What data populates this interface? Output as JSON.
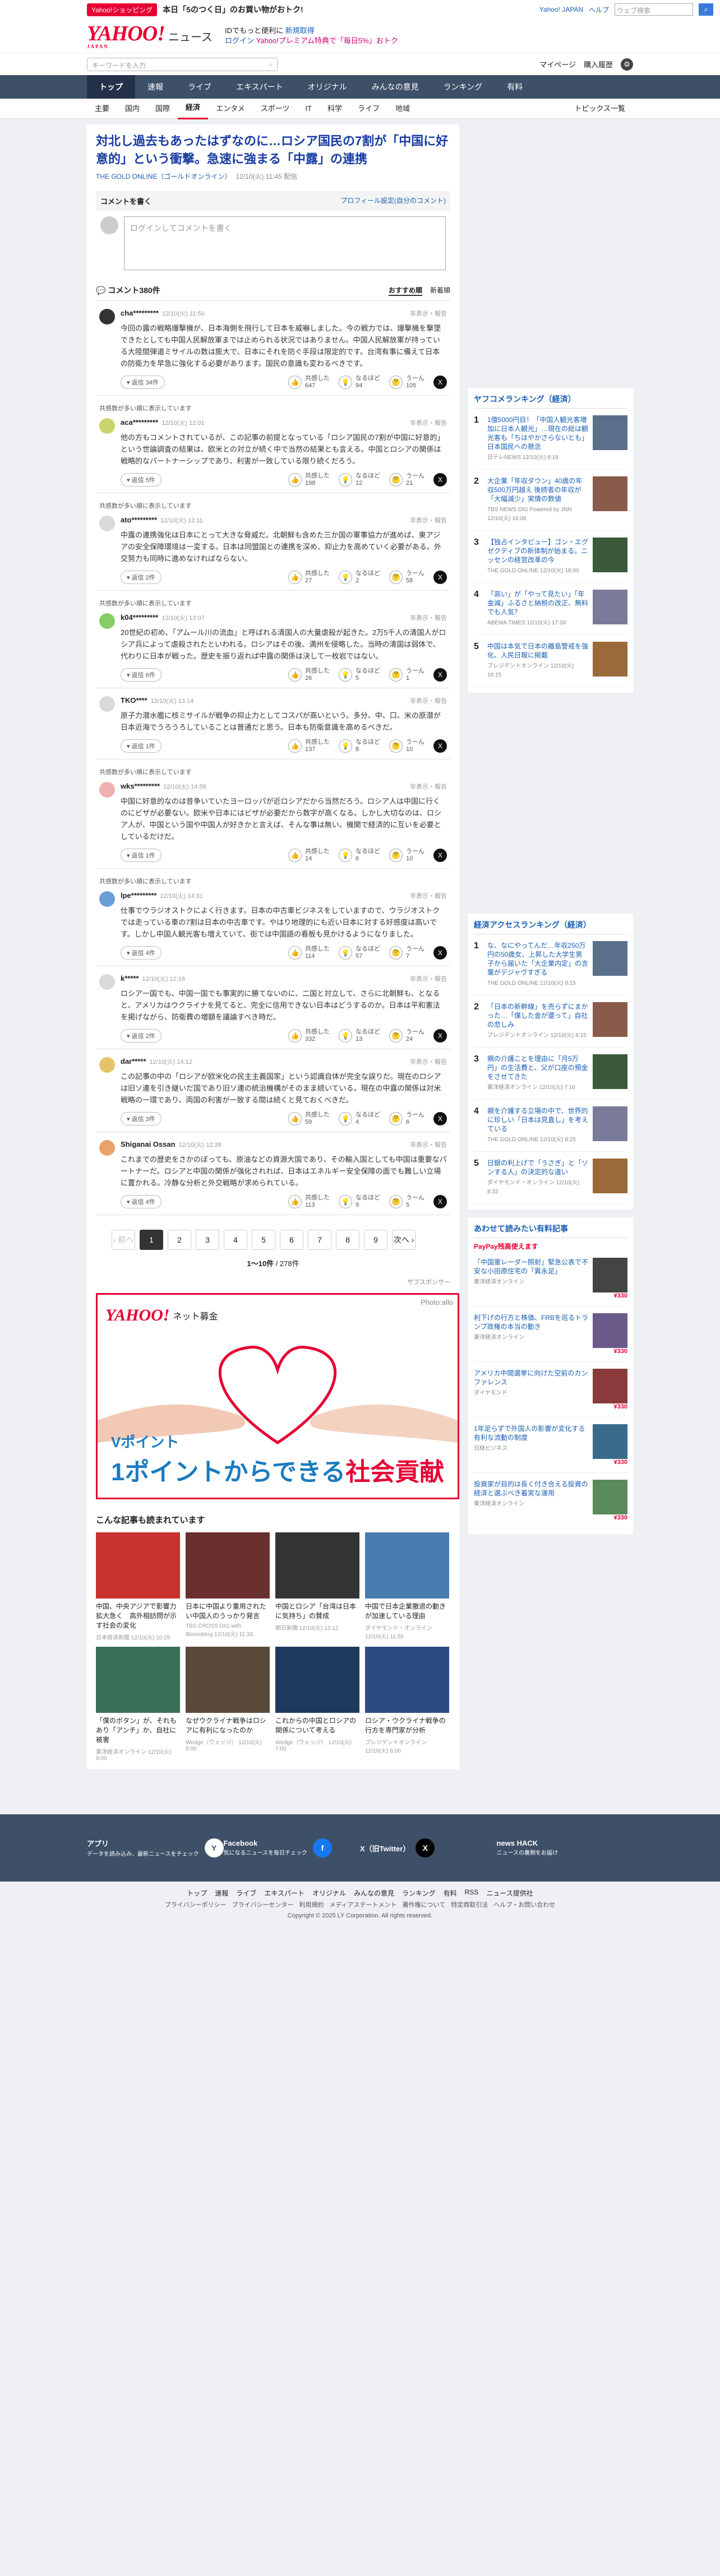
{
  "topbar": {
    "badge": "Yahoo!ショッピング",
    "promo": "本日「5のつく日」のお買い物がおトク!",
    "help_link": "ヘルプ",
    "jp_link": "Yahoo! JAPAN",
    "search_placeholder": "ウェブ検索"
  },
  "header": {
    "logo": "YAHOO!",
    "logo_sub": "JAPAN",
    "site": "ニュース",
    "line1": "IDでもっと便利に",
    "line1_link": "新規取得",
    "line2": "ログイン",
    "line3": "Yahoo!プレミアム特典で「毎日5%」おトク"
  },
  "subheader": {
    "search_placeholder": "キーワードを入力",
    "mypage": "マイページ",
    "purchase": "購入履歴"
  },
  "nav1": [
    "トップ",
    "速報",
    "ライブ",
    "エキスパート",
    "オリジナル",
    "みんなの意見",
    "ランキング",
    "有料"
  ],
  "nav2": [
    "主要",
    "国内",
    "国際",
    "経済",
    "エンタメ",
    "スポーツ",
    "IT",
    "科学",
    "ライフ",
    "地域"
  ],
  "nav2_right": "トピックス一覧",
  "article": {
    "title": "対北し過去もあったはずなのに…ロシア国民の7割が「中国に好意的」という衝撃。急速に強まる「中露」の連携",
    "source": "THE GOLD ONLINE（ゴールドオンライン）",
    "time": "12/10(火) 11:45 配信"
  },
  "comment_box": {
    "label": "コメントを書く",
    "profile_link": "プロフィール設定(自分のコメント)",
    "placeholder": "ログインしてコメントを書く"
  },
  "comments_head": {
    "count": "コメント380件",
    "sort_rec": "おすすめ順",
    "sort_new": "新着順"
  },
  "comments": [
    {
      "user": "cha*********",
      "time": "12/10(火) 11:50",
      "report": "非表示・報告",
      "text": "今回の露の戦略爆撃機が、日本海側を飛行して日本を威嚇しました。今の戦力では、爆撃機を撃墜できたとしても中国人民解放軍までは止められる状況ではありません。中国人民解放軍が持っている大陸間弾道ミサイルの数は膨大で、日本にそれを防ぐ手段は限定的です。台湾有事に備えて日本の防衛力を早急に強化する必要があります。国民の意識も変わるべきです。",
      "reply": "返信 34件",
      "v1": "共感した",
      "n1": "647",
      "v2": "なるほど",
      "n2": "94",
      "v3": "うーん",
      "n3": "105",
      "pick": ""
    },
    {
      "user": "aca*********",
      "time": "12/10(火) 12:01",
      "report": "非表示・報告",
      "text": "他の方もコメントされているが、この記事の前提となっている「ロシア国民の7割が中国に好意的」という世論調査の結果は、欧米との対立が続く中で当然の結果とも言える。中国とロシアの関係は戦略的なパートナーシップであり、利害が一致している限り続くだろう。",
      "reply": "返信 5件",
      "v1": "共感した",
      "n1": "198",
      "v2": "なるほど",
      "n2": "12",
      "v3": "うーん",
      "n3": "21",
      "pick": "共感数が多い順に表示しています"
    },
    {
      "user": "ato*********",
      "time": "12/10(火) 12:11",
      "report": "非表示・報告",
      "text": "中露の連携強化は日本にとって大きな脅威だ。北朝鮮も含めた三か国の軍事協力が進めば、東アジアの安全保障環境は一変する。日本は同盟国との連携を深め、抑止力を高めていく必要がある。外交努力も同時に進めなければならない。",
      "reply": "返信 2件",
      "v1": "共感した",
      "n1": "27",
      "v2": "なるほど",
      "n2": "2",
      "v3": "うーん",
      "n3": "58",
      "pick": "共感数が多い順に表示しています"
    },
    {
      "user": "k04*********",
      "time": "12/10(火) 13:07",
      "report": "非表示・報告",
      "text": "20世紀の初め、「アムール川の流血」と呼ばれる清国人の大量虐殺が起きた。2万5千人の清国人がロシア兵によって虐殺されたといわれる。ロシアはその後、満州を侵略した。当時の清国は弱体で、代わりに日本が戦った。歴史を振り返れば中露の関係は決して一枚岩ではない。",
      "reply": "返信 6件",
      "v1": "共感した",
      "n1": "26",
      "v2": "なるほど",
      "n2": "5",
      "v3": "うーん",
      "n3": "1",
      "pick": "共感数が多い順に表示しています"
    },
    {
      "user": "TKO****",
      "time": "12/10(火) 13:14",
      "report": "非表示・報告",
      "text": "原子力潜水艦に核ミサイルが戦争の抑止力としてコスパが高いという。多分、中、口、米の原潜が日本近海でうろうろしていることは普通だと思う。日本も防衛意識を高めるべきだ。",
      "reply": "返信 1件",
      "v1": "共感した",
      "n1": "137",
      "v2": "なるほど",
      "n2": "8",
      "v3": "うーん",
      "n3": "10",
      "pick": ""
    },
    {
      "user": "wks*********",
      "time": "12/10(火) 14:58",
      "report": "非表示・報告",
      "text": "中国に好意的なのは昔争いていたヨーロッパが近ロシアだから当然だろう。ロシア人は中国に行くのにビザが必要ない。欧米や日本にはビザが必要だから数字が高くなる。しかし大切なのは、ロシア人が、中国という国や中国人が好きかと言えば、そんな事は無い。機関で経済的に互いを必要としているだけだ。",
      "reply": "返信 1件",
      "v1": "共感した",
      "n1": "14",
      "v2": "なるほど",
      "n2": "6",
      "v3": "うーん",
      "n3": "10",
      "pick": "共感数が多い順に表示しています"
    },
    {
      "user": "lpe*********",
      "time": "12/10(火) 14:31",
      "report": "非表示・報告",
      "text": "仕事でウラジオストクによく行きます。日本の中古車ビジネスをしていますので、ウラジオストクでは走っている車の7割は日本の中古車です。やはり地理的にも近い日本に対する好感度は高いです。しかし中国人観光客も増えていて、街では中国語の看板も見かけるようになりました。",
      "reply": "返信 4件",
      "v1": "共感した",
      "n1": "114",
      "v2": "なるほど",
      "n2": "57",
      "v3": "うーん",
      "n3": "7",
      "pick": "共感数が多い順に表示しています"
    },
    {
      "user": "k*****",
      "time": "12/10(火) 12:16",
      "report": "非表示・報告",
      "text": "ロシア一国でも、中国一国でも事実的に勝てないのに、二国と対立して、さらに北朝鮮も、となると、アメリカはウクライナを見てると、完全に信用できない日本はどうするのか。日本は平和憲法を掲げながら、防衛費の増額を議論すべき時だ。",
      "reply": "返信 2件",
      "v1": "共感した",
      "n1": "332",
      "v2": "なるほど",
      "n2": "13",
      "v3": "うーん",
      "n3": "24",
      "pick": ""
    },
    {
      "user": "dar*****",
      "time": "12/10(火) 14:12",
      "report": "非表示・報告",
      "text": "この記事の中の「ロシアが欧米化の民主主義国家」という認識自体が完全な誤りだ。現在のロシアは旧ソ連を引き継いだ国であり旧ソ連の統治機構がそのまま続いている。現在の中露の関係は対米戦略の一環であり、両国の利害が一致する間は続くと見ておくべきだ。",
      "reply": "返信 3件",
      "v1": "共感した",
      "n1": "59",
      "v2": "なるほど",
      "n2": "4",
      "v3": "うーん",
      "n3": "6",
      "pick": ""
    },
    {
      "user": "Shiganai Ossan",
      "time": "12/10(火) 12:38",
      "report": "非表示・報告",
      "text": "これまでの歴史をさかのぼっても、原油などの資源大国であり、その輸入国としても中国は重要なパートナーだ。ロシアと中国の関係が強化されれば、日本はエネルギー安全保障の面でも難しい立場に置かれる。冷静な分析と外交戦略が求められている。",
      "reply": "返信 4件",
      "v1": "共感した",
      "n1": "113",
      "v2": "なるほど",
      "n2": "9",
      "v3": "うーん",
      "n3": "5",
      "pick": ""
    }
  ],
  "pager": {
    "prev": "前へ",
    "pages": [
      "1",
      "2",
      "3",
      "4",
      "5",
      "6",
      "7",
      "8",
      "9"
    ],
    "next": "次へ",
    "count_bold": "1〜10件",
    "count_total": "/ 278件"
  },
  "ad": {
    "label": "サプスポンサー",
    "logo": "YAHOO!",
    "bank": "ネット募金",
    "photo": "Photo:allo",
    "small": "Vポイント",
    "line1": "1ポイントからできる",
    "line2": "社会貢献"
  },
  "related": {
    "heading": "こんな記事も読まれています",
    "items": [
      {
        "title": "中国、中央アジアで影響力拡大急く　高外相訪問が示す社会の変化",
        "src": "日本経済新聞",
        "time": "12/10(火) 10:25",
        "c": "#c9322e"
      },
      {
        "title": "日本に中国より重用されたい中国人のうっかり発言",
        "src": "TBS CROSS DIG with Bloomberg",
        "time": "12/10(火) 11:33",
        "c": "#6a2f2f"
      },
      {
        "title": "中国とロシア「台湾は日本に気持ち」の賛成",
        "src": "朝日新聞",
        "time": "12/10(火) 13:12",
        "c": "#333"
      },
      {
        "title": "中国で日本企業撤退の動きが加速している理由",
        "src": "ダイヤモンド・オンライン",
        "time": "12/10(火) 11:55",
        "c": "#4a7bb0"
      },
      {
        "title": "「僕のボタン」が、それもあり「アンチ」か、自社に被害",
        "src": "東洋経済オンライン",
        "time": "12/10(火) 9:00",
        "c": "#3a6f58"
      },
      {
        "title": "なぜウクライナ戦争はロシアに有利になったのか",
        "src": "Wedge（ウェッジ）",
        "time": "12/10(火) 8:00",
        "c": "#5a4a3a"
      },
      {
        "title": "これからの中国とロシアの関係について考える",
        "src": "Wedge（ウェッジ）",
        "time": "12/10(火) 7:00",
        "c": "#1f3a5f"
      },
      {
        "title": "ロシア・ウクライナ戦争の行方を専門家が分析",
        "src": "プレジデントオンライン",
        "time": "12/10(火) 6:00",
        "c": "#2d4a80"
      }
    ]
  },
  "ranking": {
    "heading": "ヤフコメランキング（経済）",
    "items": [
      {
        "n": "1",
        "title": "1億5000円目！「中国人観光客増加に日本人観光」…現在の総は観光客も「ちはやかさらないとも」日本国民への懸念",
        "src": "日テレNEWS",
        "time": "12/10(火) 8:19"
      },
      {
        "title": "大企業「年収ダウン」40歳の年収500万円越え 後続者の年収が「大幅減少」実情の数値",
        "n": "2",
        "src": "TBS NEWS DIG Powered by JNN",
        "time": "12/10(火) 16:08"
      },
      {
        "n": "3",
        "title": "【独占インタビュー】ゴン・エグゼクティブの新体制が始まる。ニッセンの経営改革の今",
        "src": "THE GOLD ONLINE",
        "time": "12/10(火) 18:00"
      },
      {
        "n": "4",
        "title": "「高い」が「やって見たい」「年金減」ふるさと納税の改正、無料でも人気？",
        "src": "ABEMA TIMES",
        "time": "12/10(火) 17:39"
      },
      {
        "n": "5",
        "title": "中国は本気で日本の離島警戒を強化、人民日報に掲載",
        "src": "プレジデントオンライン",
        "time": "12/10(火) 16:15"
      }
    ]
  },
  "ranking2": {
    "heading": "経済アクセスランキング（経済）",
    "items": [
      {
        "n": "1",
        "title": "な、なにやってんだ…年収250万円の50歳女、上昇した大学生男子から届いた「大企業内定」の言葉がデジャヴすぎる",
        "src": "THE GOLD ONLINE",
        "time": "12/10(火) 8:15"
      },
      {
        "n": "2",
        "title": "「日本の新幹線」を売らずにまかった…「僕した金が還って」自社の悲しみ",
        "src": "プレジデントオンライン",
        "time": "12/10(火) 8:15"
      },
      {
        "n": "3",
        "title": "親の介護ことを理由に「月5万円」の生活費と、父が口座の預金をさせてきた",
        "src": "東洋経済オンライン",
        "time": "12/10(火) 7:10"
      },
      {
        "n": "4",
        "title": "親を介護する立場の中で、世界的に珍しい「日本は見直し」を考えている",
        "src": "THE GOLD ONLINE",
        "time": "12/10(火) 8:25"
      },
      {
        "n": "5",
        "title": "日銀の利上げで「うさぎ」と「ソンする人」の決定的な違い",
        "src": "ダイヤモンド・オンライン",
        "time": "12/10(火) 8:32"
      }
    ]
  },
  "shopping": {
    "heading": "あわせて読みたい有料記事",
    "premium": "PayPay残高使えます",
    "items": [
      {
        "title": "「中国軍レーダー照射」緊急公表で不安な小田原住宅の「異永足」",
        "src": "東洋経済オンライン",
        "price": "¥330"
      },
      {
        "title": "利下げの行方と株価、FRBを巡るトランプ政権の本当の動き",
        "src": "東洋経済オンライン",
        "price": "¥330"
      },
      {
        "title": "アメリカ中間選挙に向けた空前のカンファレンス",
        "src": "ダイヤモンド",
        "price": "¥330"
      },
      {
        "title": "1年足らずで外国人の影響が変化する有利な流動の制度",
        "src": "日経ビジネス",
        "price": "¥330"
      },
      {
        "title": "投資家が目的は長く付き合える投資の経済と選ぶべき着実な運用",
        "src": "東洋経済オンライン",
        "price": "¥330"
      }
    ]
  },
  "footer": {
    "apps": "アプリ",
    "apps_sub": "データを読み込み、最新ニュースをチェック",
    "fb": "Facebook",
    "fb_sub": "気になるニュースを毎日チェック",
    "x": "X（旧Twitter）",
    "x_sub": "",
    "hack": "news HACK",
    "hack_sub": "ニュースの裏側をお届け",
    "links": [
      "トップ",
      "速報",
      "ライブ",
      "エキスパート",
      "オリジナル",
      "みんなの意見",
      "ランキング",
      "有料",
      "RSS",
      "ニュース提供社"
    ],
    "links2": [
      "プライバシーポリシー",
      "プライバシーセンター",
      "利用規約",
      "メディアステートメント",
      "著作権について",
      "特定商取引法",
      "ヘルプ・お問い合わせ"
    ],
    "copyright": "Copyright © 2025 LY Corporation. All rights reserved."
  }
}
